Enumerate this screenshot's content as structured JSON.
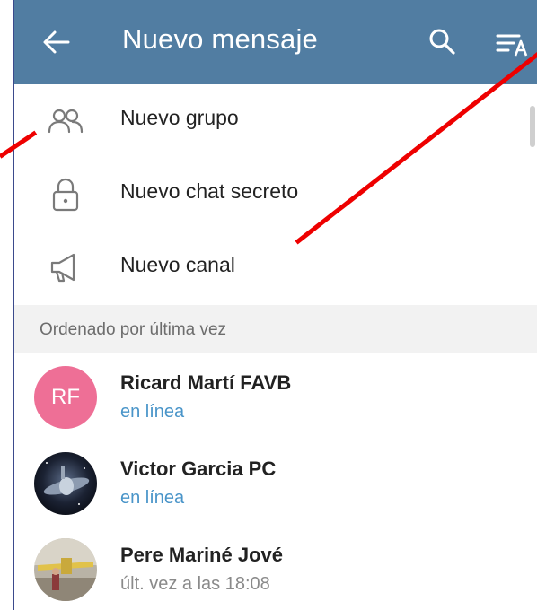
{
  "colors": {
    "appbar": "#517da2",
    "accent_link": "#4a95c9",
    "annotation": "#ee0000",
    "avatar_rf": "#ee6f96",
    "section_bg": "#f2f2f2"
  },
  "appbar": {
    "title": "Nuevo mensaje",
    "back_icon": "arrow-back-icon",
    "search_icon": "search-icon",
    "sort_icon": "sort-by-name-icon"
  },
  "menu": [
    {
      "label": "Nuevo grupo",
      "icon": "group-icon"
    },
    {
      "label": "Nuevo chat secreto",
      "icon": "lock-icon"
    },
    {
      "label": "Nuevo canal",
      "icon": "megaphone-icon"
    }
  ],
  "section": {
    "header": "Ordenado por última vez"
  },
  "contacts": [
    {
      "name": "Ricard Martí FAVB",
      "status": "en línea",
      "initials": "RF",
      "online": true
    },
    {
      "name": "Victor Garcia PC",
      "status": "en línea",
      "initials": "",
      "online": true
    },
    {
      "name": "Pere Mariné Jové",
      "status": "últ. vez a las 18:08",
      "initials": "",
      "online": false
    }
  ]
}
